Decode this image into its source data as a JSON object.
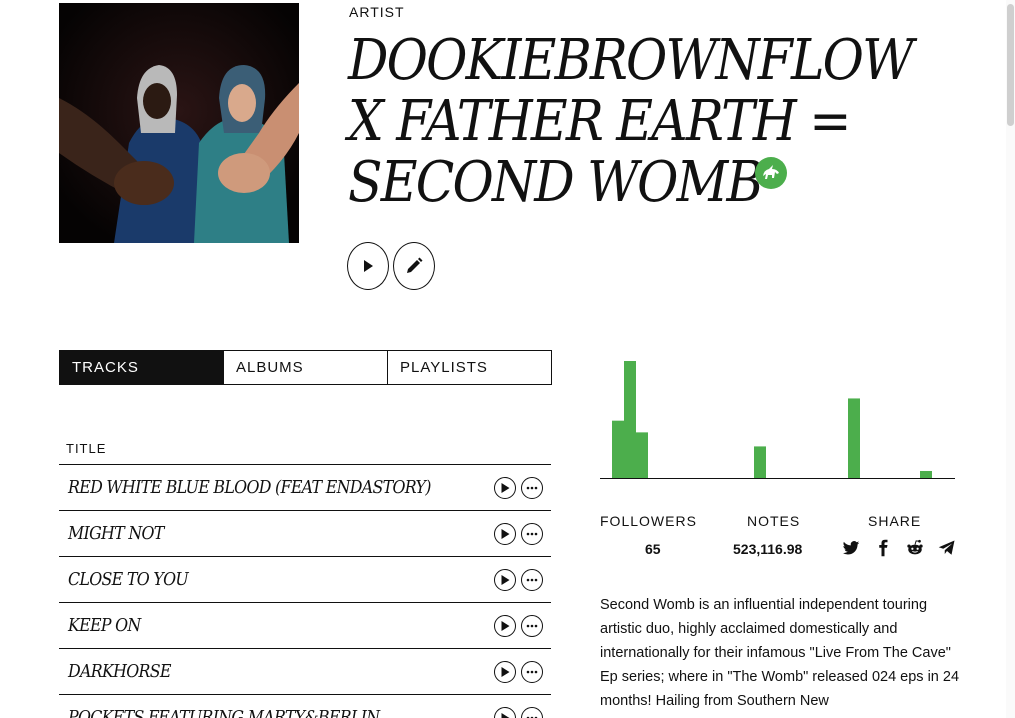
{
  "artist": {
    "kicker": "ARTIST",
    "name": "DOOKIEBROWNFLOW X FATHER EARTH = SECOND WOMB"
  },
  "icons": {
    "verified": "unicorn-badge-icon",
    "play": "play-icon",
    "edit": "pencil-icon",
    "more": "more-dots-icon",
    "twitter": "twitter-icon",
    "facebook": "facebook-icon",
    "reddit": "reddit-icon",
    "telegram": "telegram-icon"
  },
  "tabs": [
    {
      "label": "TRACKS",
      "active": true
    },
    {
      "label": "ALBUMS",
      "active": false
    },
    {
      "label": "PLAYLISTS",
      "active": false
    }
  ],
  "tracklist": {
    "column_title": "TITLE",
    "tracks": [
      {
        "title": "RED WHITE BLUE BLOOD (FEAT ENDASTORY)"
      },
      {
        "title": "MIGHT NOT"
      },
      {
        "title": "CLOSE TO YOU"
      },
      {
        "title": "KEEP ON"
      },
      {
        "title": "DARKHORSE"
      },
      {
        "title": "POCKETS FEATURING MARTY&BERLIN..."
      }
    ]
  },
  "activity_histogram": {
    "bars": [
      0.49,
      1.0,
      0.39,
      0.27,
      0.68,
      0.06
    ]
  },
  "stats": {
    "followers_label": "FOLLOWERS",
    "followers_value": "65",
    "notes_label": "NOTES",
    "notes_value": "523,116.98",
    "share_label": "SHARE"
  },
  "bio": "Second Womb is an influential independent touring artistic duo, highly acclaimed domestically and internationally for their infamous \"Live From The Cave\" Ep series; where in \"The Womb\" released 024 eps in 24 months! Hailing from Southern New",
  "colors": {
    "accent_green": "#4cae4c",
    "text": "#111111",
    "tab_active_bg": "#111111"
  }
}
